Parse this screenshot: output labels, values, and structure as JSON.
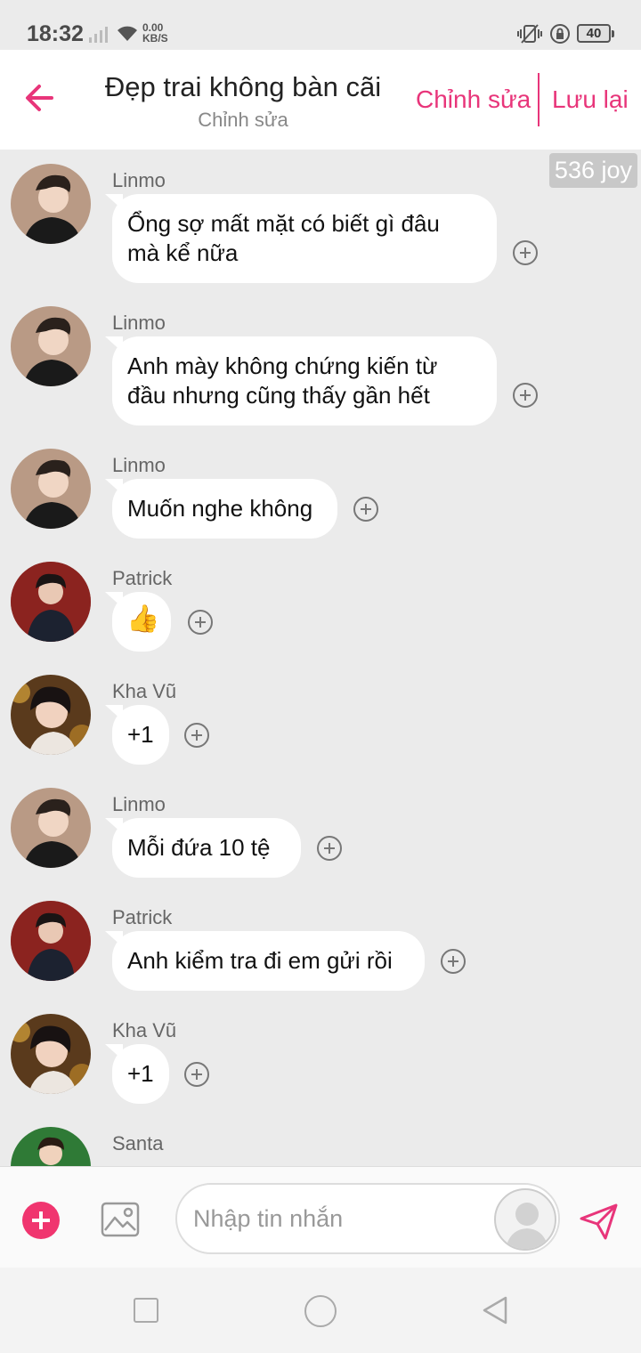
{
  "status_bar": {
    "time": "18:32",
    "net_speed_value": "0.00",
    "net_speed_unit": "KB/S",
    "battery": "40",
    "icons": [
      "signal-icon",
      "wifi-icon",
      "vibrate-icon",
      "rotation-lock-icon",
      "battery-icon"
    ]
  },
  "header": {
    "title": "Đẹp trai không bàn cãi",
    "subtitle": "Chỉnh sửa",
    "edit_label": "Chỉnh sửa",
    "save_label": "Lưu lại",
    "accent_color": "#e8357a"
  },
  "chat": {
    "joy_badge": "536 joy",
    "messages": [
      {
        "sender": "Linmo",
        "lines": [
          "Ổng sợ mất mặt có biết gì đâu",
          "mà kể nữa"
        ]
      },
      {
        "sender": "Linmo",
        "lines": [
          "Anh mày không chứng kiến từ",
          "đầu nhưng cũng thấy gần hết"
        ]
      },
      {
        "sender": "Linmo",
        "lines": [
          "Muốn nghe không"
        ]
      },
      {
        "sender": "Patrick",
        "lines": [
          "👍"
        ]
      },
      {
        "sender": "Kha Vũ",
        "lines": [
          "+1"
        ]
      },
      {
        "sender": "Linmo",
        "lines": [
          "Mỗi đứa 10 tệ"
        ]
      },
      {
        "sender": "Patrick",
        "lines": [
          "Anh kiểm tra đi em gửi rồi"
        ]
      },
      {
        "sender": "Kha Vũ",
        "lines": [
          "+1"
        ]
      },
      {
        "sender": "Santa",
        "lines": []
      }
    ]
  },
  "input_bar": {
    "placeholder": "Nhập tin nhắn",
    "add_color": "#f0356f"
  }
}
